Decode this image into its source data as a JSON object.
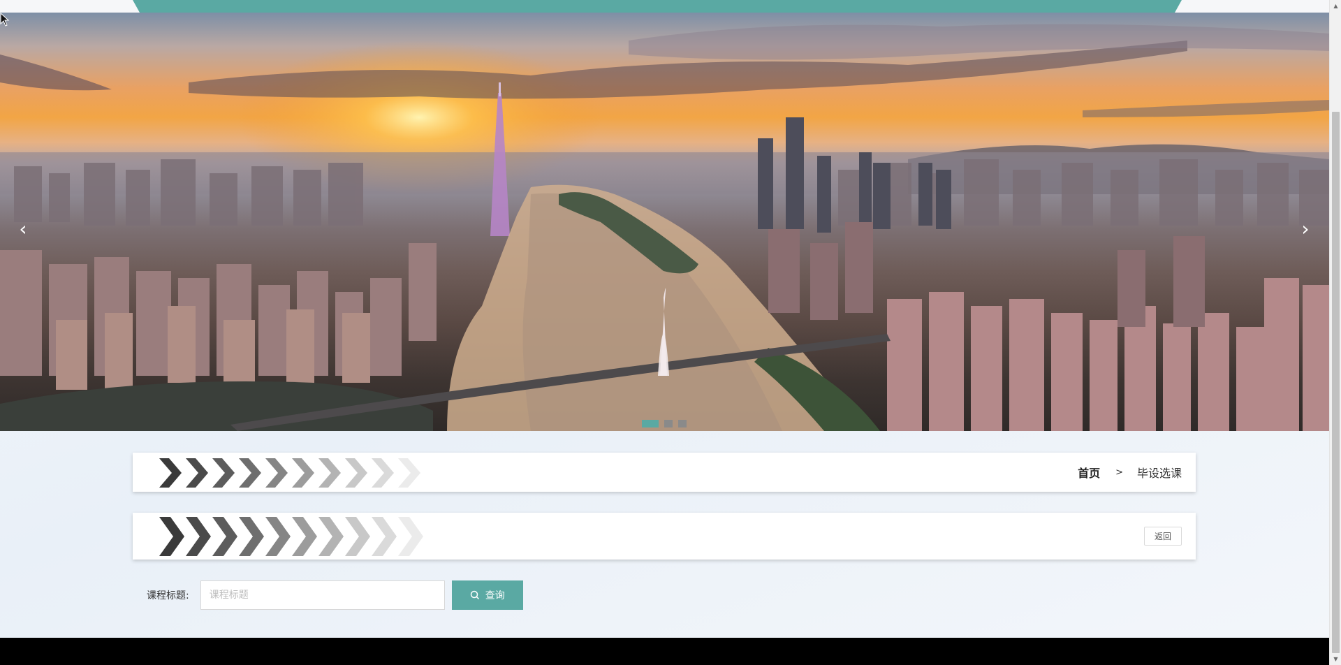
{
  "banner": {
    "prev_icon": "‹",
    "next_icon": "›",
    "slides": 3,
    "active_slide": 1
  },
  "breadcrumb": {
    "home": "首页",
    "separator": ">",
    "current": "毕设选课"
  },
  "toolbar": {
    "back_label": "返回"
  },
  "search": {
    "label": "课程标题:",
    "placeholder": "课程标题",
    "value": "",
    "button_label": "查询"
  },
  "colors": {
    "accent": "#5aa9a3",
    "footer": "#000000"
  },
  "icons": {
    "chevron_pattern": "chevron-decoration-icon",
    "search": "search-icon",
    "prev": "chevron-left-icon",
    "next": "chevron-right-icon"
  }
}
